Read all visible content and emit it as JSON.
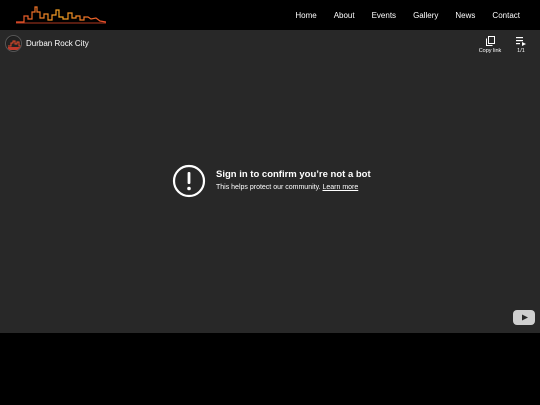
{
  "nav": {
    "items": [
      "Home",
      "About",
      "Events",
      "Gallery",
      "News",
      "Contact"
    ]
  },
  "player": {
    "channel_title": "Durban Rock City",
    "actions": {
      "copy_link": "Copy link",
      "playlist_count": "1/1"
    },
    "message": {
      "title": "Sign in to confirm you’re not a bot",
      "body": "This helps protect our community.",
      "link": "Learn more"
    }
  },
  "colors": {
    "logo_gradient": [
      "#e84a2a",
      "#f5a623"
    ],
    "player_bg": "#282828"
  },
  "icons": [
    "skyline-logo",
    "channel-avatar",
    "copy-icon",
    "playlist-icon",
    "warning-icon",
    "youtube-icon"
  ]
}
